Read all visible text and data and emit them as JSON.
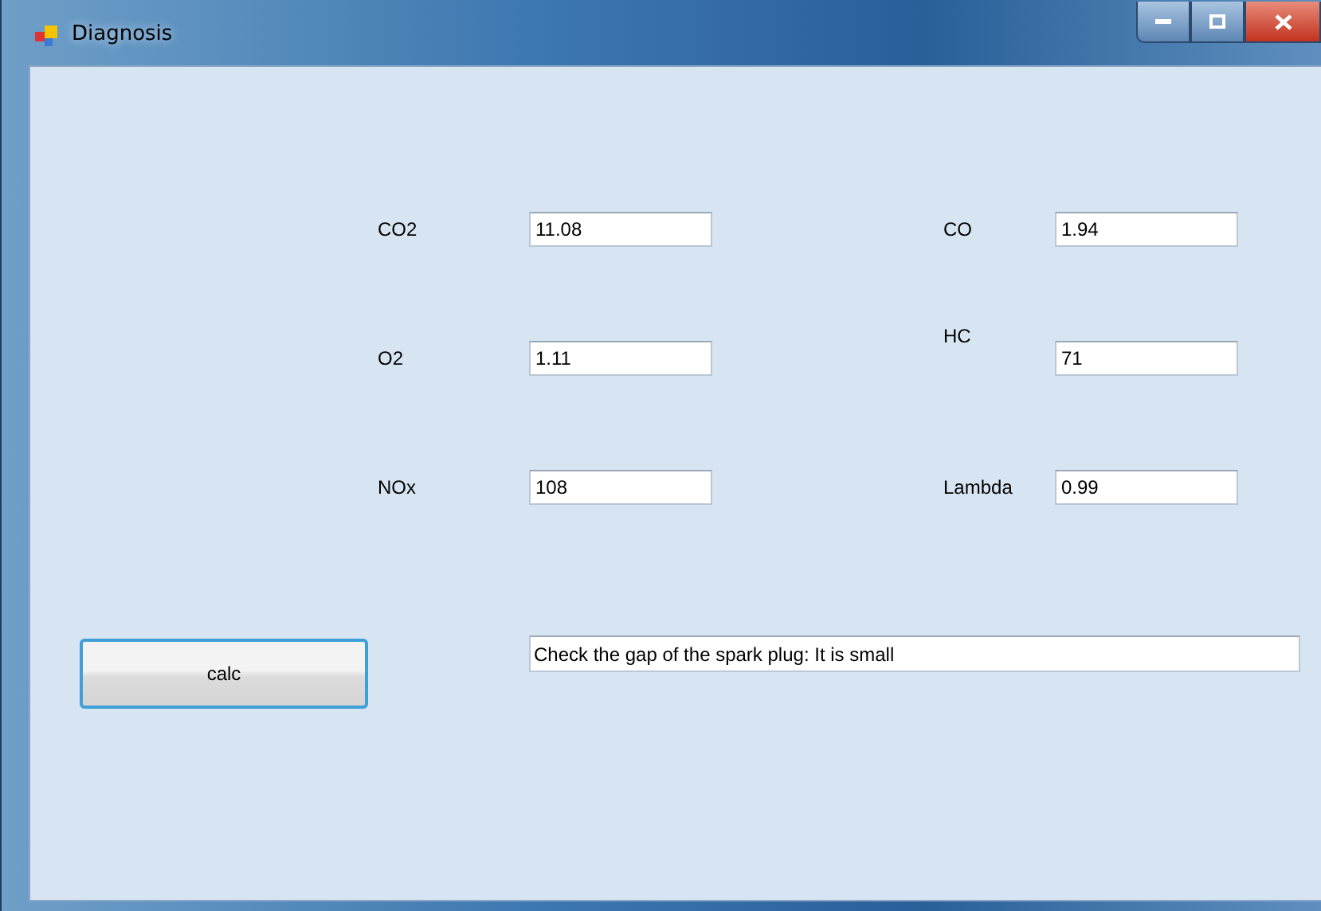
{
  "window": {
    "title": "Diagnosis"
  },
  "left_fields": [
    {
      "label": "CO2",
      "value": "11.08"
    },
    {
      "label": "O2",
      "value": "1.11"
    },
    {
      "label": "NOx",
      "value": "108"
    }
  ],
  "right_fields": [
    {
      "label": "CO",
      "value": "1.94"
    },
    {
      "label": "HC",
      "value": "71"
    },
    {
      "label": "Lambda",
      "value": "0.99"
    }
  ],
  "button": {
    "label": "calc"
  },
  "result": {
    "value": "Check the gap of the spark plug: It is small"
  }
}
